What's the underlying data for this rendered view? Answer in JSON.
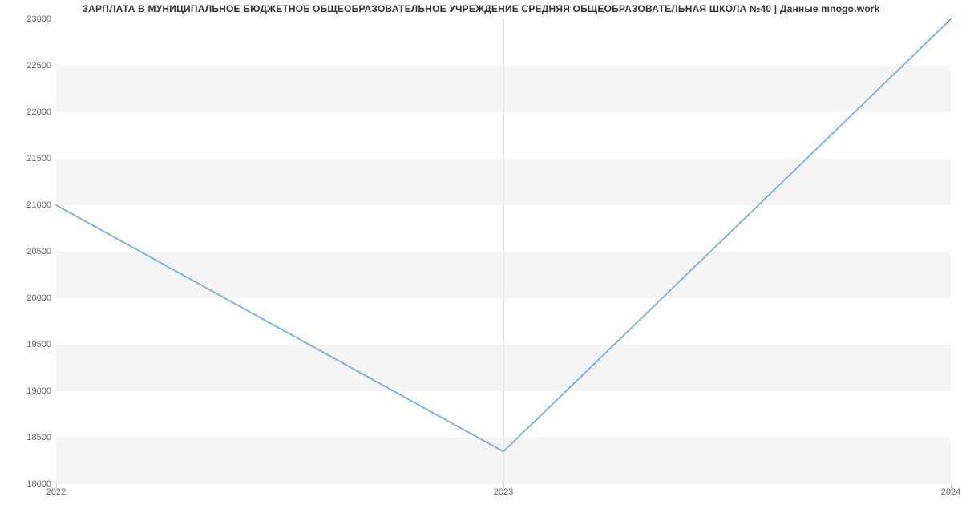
{
  "chart_data": {
    "type": "line",
    "title": "ЗАРПЛАТА В МУНИЦИПАЛЬНОЕ БЮДЖЕТНОЕ ОБЩЕОБРАЗОВАТЕЛЬНОЕ УЧРЕЖДЕНИЕ СРЕДНЯЯ ОБЩЕОБРАЗОВАТЕЛЬНАЯ ШКОЛА №40 | Данные mnogo.work",
    "x": [
      "2022",
      "2023",
      "2024"
    ],
    "values": [
      21000,
      18350,
      23000
    ],
    "xlabel": "",
    "ylabel": "",
    "ylim": [
      18000,
      23000
    ],
    "y_ticks": [
      18000,
      18500,
      19000,
      19500,
      20000,
      20500,
      21000,
      21500,
      22000,
      22500,
      23000
    ],
    "x_ticks": [
      "2022",
      "2023",
      "2024"
    ],
    "colors": {
      "line": "#7cb5ec",
      "band": "#f4f4f4"
    }
  }
}
